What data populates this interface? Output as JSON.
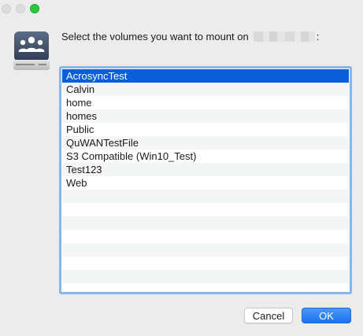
{
  "window": {
    "traffic_lights": [
      "close",
      "minimize",
      "zoom"
    ],
    "zoom_color": "#27c93f"
  },
  "dialog": {
    "icon": "network-drive-users-icon",
    "prompt_text": "Select the volumes you want to mount on",
    "prompt_suffix": ":",
    "accent_color": "#0a5fd9"
  },
  "volumes": {
    "items": [
      {
        "label": "AcrosyncTest",
        "selected": true
      },
      {
        "label": "Calvin",
        "selected": false
      },
      {
        "label": "home",
        "selected": false
      },
      {
        "label": "homes",
        "selected": false
      },
      {
        "label": "Public",
        "selected": false
      },
      {
        "label": "QuWANTestFile",
        "selected": false
      },
      {
        "label": "S3 Compatible (Win10_Test)",
        "selected": false
      },
      {
        "label": "Test123",
        "selected": false
      },
      {
        "label": "Web",
        "selected": false
      }
    ]
  },
  "buttons": {
    "cancel_label": "Cancel",
    "ok_label": "OK"
  }
}
